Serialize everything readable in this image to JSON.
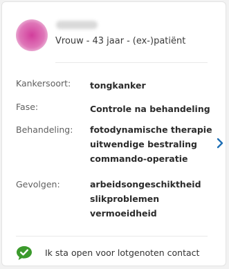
{
  "profile": {
    "gender": "Vrouw",
    "age": "43 jaar",
    "role": "(ex-)patiënt",
    "separator": "-"
  },
  "details": {
    "cancer_type": {
      "label": "Kankersoort:",
      "values": [
        "tongkanker"
      ]
    },
    "phase": {
      "label": "Fase:",
      "values": [
        "Controle na behandeling"
      ]
    },
    "treatment": {
      "label": "Behandeling:",
      "values": [
        "fotodynamische therapie",
        "uitwendige bestraling",
        "commando-operatie"
      ]
    },
    "consequences": {
      "label": "Gevolgen:",
      "values": [
        "arbeidsongeschiktheid",
        "slikproblemen",
        "vermoeidheid"
      ]
    }
  },
  "contact": {
    "text": "Ik sta open voor lotgenoten contact",
    "icon": "chat-check-icon"
  },
  "colors": {
    "accent_blue": "#1f6fb5",
    "check_green": "#3b9a2c",
    "avatar_pink": "#d23e9c"
  }
}
